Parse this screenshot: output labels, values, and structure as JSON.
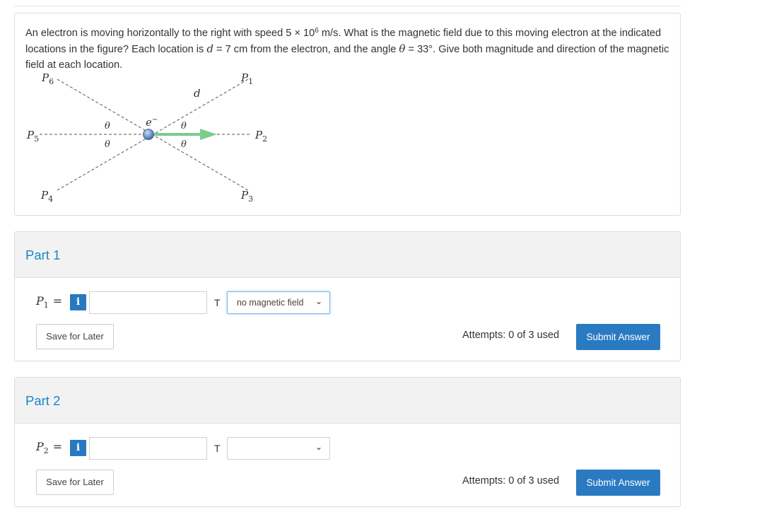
{
  "question": {
    "text_1": "An electron is moving horizontally to the right with speed 5 × 10",
    "speed_exponent": "6",
    "text_2": " m/s. What is the magnetic field due to this moving electron at the indicated locations in the figure? Each location is ",
    "d_symbol": "d",
    "text_3": " = 7 cm from the electron, and the angle ",
    "theta_symbol": "θ",
    "text_4": " = 33°. Give both magnitude and direction of the magnetic field at each location."
  },
  "diagram": {
    "p1": "P",
    "p1_sub": "1",
    "p2": "P",
    "p2_sub": "2",
    "p3": "P",
    "p3_sub": "3",
    "p4": "P",
    "p4_sub": "4",
    "p5": "P",
    "p5_sub": "5",
    "p6": "P",
    "p6_sub": "6",
    "d_label": "d",
    "electron_label": "e",
    "electron_sup": "−",
    "theta": "θ",
    "colors": {
      "velocity_arrow": "#7ccc8c",
      "electron": "#5a86c4",
      "dash": "#555555"
    }
  },
  "parts": [
    {
      "title": "Part 1",
      "point": "P",
      "point_sub": "1",
      "equals": "=",
      "info_icon": "i",
      "answer_value": "",
      "unit": "T",
      "direction_selected": "no magnetic field",
      "save_label": "Save for Later",
      "attempts": "Attempts: 0 of 3 used",
      "submit_label": "Submit Answer"
    },
    {
      "title": "Part 2",
      "point": "P",
      "point_sub": "2",
      "equals": "=",
      "info_icon": "i",
      "answer_value": "",
      "unit": "T",
      "direction_selected": "",
      "save_label": "Save for Later",
      "attempts": "Attempts: 0 of 3 used",
      "submit_label": "Submit Answer"
    }
  ],
  "colors": {
    "accent": "#2a7ac2",
    "part_title": "#1a86c8"
  }
}
